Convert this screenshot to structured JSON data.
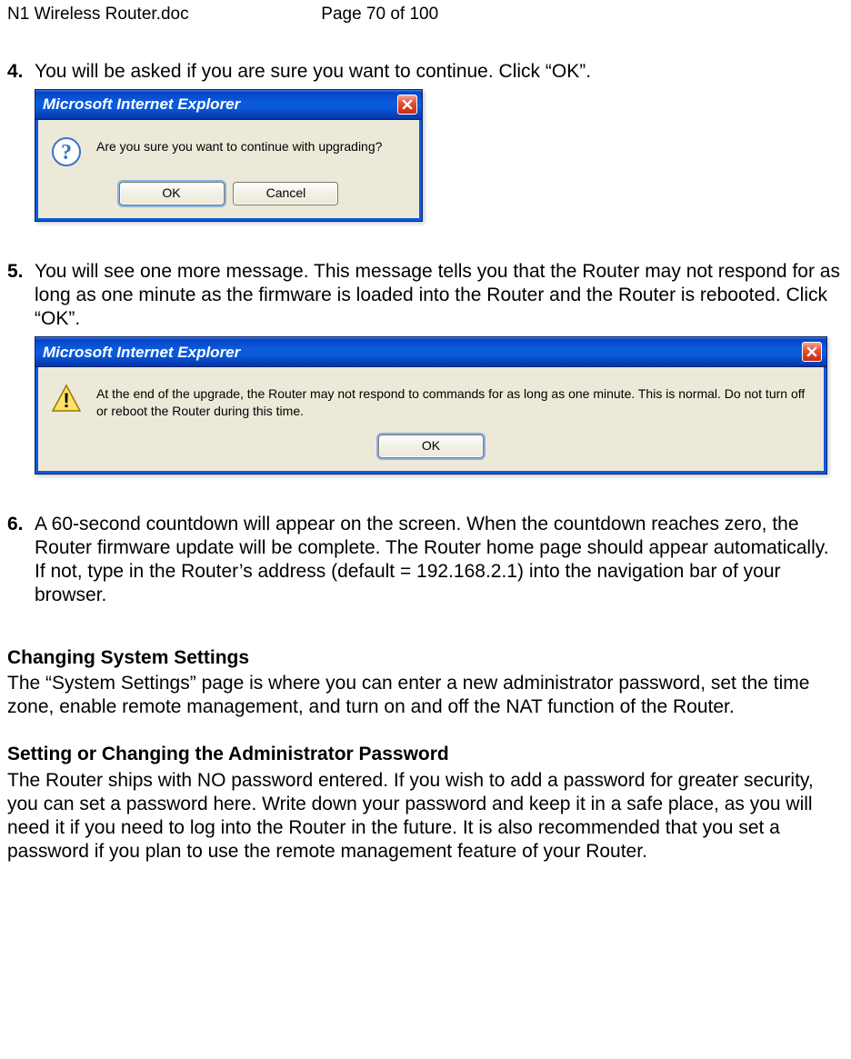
{
  "header": {
    "filename": "N1 Wireless Router.doc",
    "page": "Page 70 of 100"
  },
  "step4": {
    "num": "4.",
    "text": "You will be asked if you are sure you want to continue. Click “OK”.",
    "dialog": {
      "title": "Microsoft Internet Explorer",
      "message": "Are you sure you want to continue with upgrading?",
      "ok": "OK",
      "cancel": "Cancel"
    }
  },
  "step5": {
    "num": "5.",
    "text": "You will see one more message. This message tells you that the Router may not respond for as long as one minute as the firmware is loaded into the Router and the Router is rebooted. Click “OK”.",
    "dialog": {
      "title": "Microsoft Internet Explorer",
      "message": "At the end of the upgrade, the Router may not respond to commands for as long as one minute. This is normal. Do not turn off or reboot the Router during this time.",
      "ok": "OK"
    }
  },
  "step6": {
    "num": "6.",
    "text": "A 60-second countdown will appear on the screen. When the countdown reaches zero, the Router firmware update will be complete. The Router home page should appear automatically. If not, type in the Router’s address (default = 192.168.2.1) into the navigation bar of your browser."
  },
  "sections": {
    "changing_heading": "Changing System Settings",
    "changing_text": "The “System Settings” page is where you can enter a new administrator password, set the time zone, enable remote management, and turn on and off the NAT function of the Router.",
    "admin_heading": "Setting or Changing the Administrator Password",
    "admin_text": "The Router ships with NO password entered. If you wish to add a password for greater security, you can set a password here. Write down your password and keep it in a safe place, as you will need it if you need to log into the Router in the future. It is also recommended that you set a password if you plan to use the remote management feature of your Router."
  }
}
